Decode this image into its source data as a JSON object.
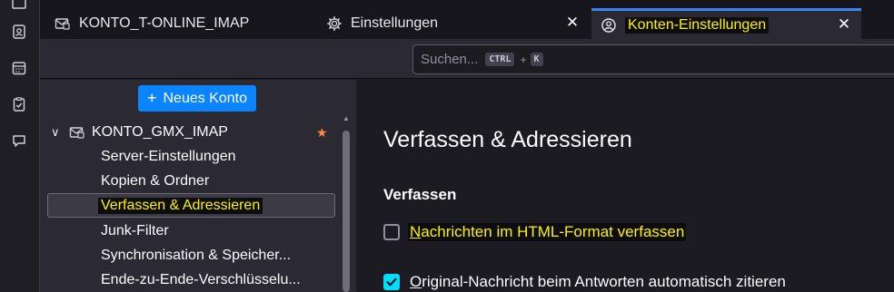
{
  "tabs": [
    {
      "label": "KONTO_T-ONLINE_IMAP",
      "icon": "mail-folder-icon",
      "closable": false
    },
    {
      "label": "Einstellungen",
      "icon": "gear-icon",
      "closable": true
    },
    {
      "label": "Konten-Einstellungen",
      "icon": "account-icon",
      "closable": true,
      "active": true
    }
  ],
  "tab_close_glyph": "✕",
  "search": {
    "placeholder": "Suchen...",
    "shortcut_key1": "CTRL",
    "shortcut_plus": "+",
    "shortcut_key2": "K"
  },
  "tree": {
    "new_account_icon": "+",
    "new_account_label": "Neues Konto",
    "account_expander": "∨",
    "account_name": "KONTO_GMX_IMAP",
    "default_star": "★",
    "items": [
      {
        "label": "Server-Einstellungen"
      },
      {
        "label": "Kopien & Ordner"
      },
      {
        "label": "Verfassen & Adressieren",
        "selected": true
      },
      {
        "label": "Junk-Filter"
      },
      {
        "label": "Synchronisation & Speicher..."
      },
      {
        "label": "Ende-zu-Ende-Verschlüsselu..."
      }
    ]
  },
  "content": {
    "page_title": "Verfassen & Adressieren",
    "section_title": "Verfassen",
    "options": [
      {
        "mnemonic": "N",
        "rest": "achrichten im HTML-Format verfassen",
        "checked": false
      },
      {
        "mnemonic": "O",
        "rest": "riginal-Nachricht beim Antworten automatisch zitieren",
        "checked": true
      }
    ]
  },
  "colors": {
    "accent": "#0a84ff",
    "checkbox_checked": "#00ddff",
    "highlight_text": "#fff200",
    "star": "#ff8a3d"
  }
}
